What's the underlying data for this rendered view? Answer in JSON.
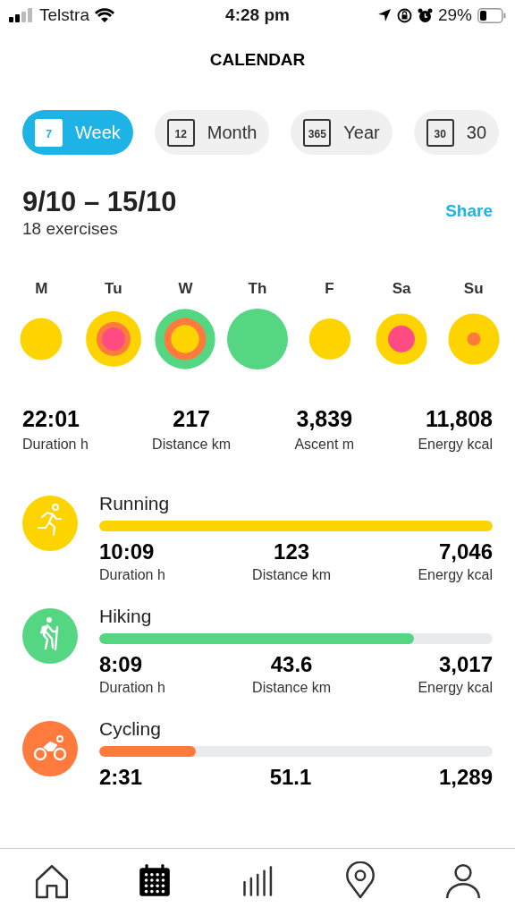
{
  "status_bar": {
    "carrier": "Telstra",
    "time": "4:28 pm",
    "battery": "29%"
  },
  "title": "CALENDAR",
  "tabs": [
    {
      "label": "Week",
      "icon_text": "7",
      "selected": true
    },
    {
      "label": "Month",
      "icon_text": "12",
      "selected": false
    },
    {
      "label": "Year",
      "icon_text": "365",
      "selected": false
    },
    {
      "label": "30",
      "icon_text": "30",
      "selected": false
    }
  ],
  "period": {
    "range": "9/10 – 15/10",
    "count": "18 exercises",
    "share": "Share"
  },
  "days": [
    {
      "label": "M",
      "rings": [
        {
          "color": "#fdd400"
        }
      ]
    },
    {
      "label": "Tu",
      "rings": [
        {
          "color": "#fdd400"
        },
        {
          "color": "#ff7a3d"
        },
        {
          "color": "#ff4b82"
        }
      ]
    },
    {
      "label": "W",
      "rings": [
        {
          "color": "#55d683"
        },
        {
          "color": "#ff7a3d"
        },
        {
          "color": "#fdd400"
        }
      ]
    },
    {
      "label": "Th",
      "rings": [
        {
          "color": "#55d683"
        }
      ]
    },
    {
      "label": "F",
      "rings": [
        {
          "color": "#fdd400"
        }
      ]
    },
    {
      "label": "Sa",
      "rings": [
        {
          "color": "#fdd400"
        },
        {
          "color": "#ff4b82"
        }
      ]
    },
    {
      "label": "Su",
      "rings": [
        {
          "color": "#fdd400"
        },
        {
          "color": "#ff7a3d"
        }
      ]
    }
  ],
  "totals": [
    {
      "value": "22:01",
      "label": "Duration h"
    },
    {
      "value": "217",
      "label": "Distance km"
    },
    {
      "value": "3,839",
      "label": "Ascent m"
    },
    {
      "value": "11,808",
      "label": "Energy kcal"
    }
  ],
  "activities": [
    {
      "name": "Running",
      "kind": "running",
      "color": "#fdd400",
      "level": 1,
      "stats": [
        {
          "value": "10:09",
          "label": "Duration h"
        },
        {
          "value": "123",
          "label": "Distance km"
        },
        {
          "value": "7,046",
          "label": "Energy kcal"
        }
      ]
    },
    {
      "name": "Hiking",
      "kind": "hiking",
      "color": "#55d683",
      "level": 0.8,
      "stats": [
        {
          "value": "8:09",
          "label": "Duration h"
        },
        {
          "value": "43.6",
          "label": "Distance km"
        },
        {
          "value": "3,017",
          "label": "Energy kcal"
        }
      ]
    },
    {
      "name": "Cycling",
      "kind": "cycling",
      "color": "#ff7a3d",
      "level": 0.245,
      "stats": [
        {
          "value": "2:31"
        },
        {
          "value": "51.1"
        },
        {
          "value": "1,289"
        }
      ]
    }
  ],
  "nav": [
    {
      "kind": "home",
      "selected": false
    },
    {
      "kind": "calendar",
      "selected": true
    },
    {
      "kind": "stats",
      "selected": false
    },
    {
      "kind": "map",
      "selected": false
    },
    {
      "kind": "profile",
      "selected": false
    }
  ]
}
